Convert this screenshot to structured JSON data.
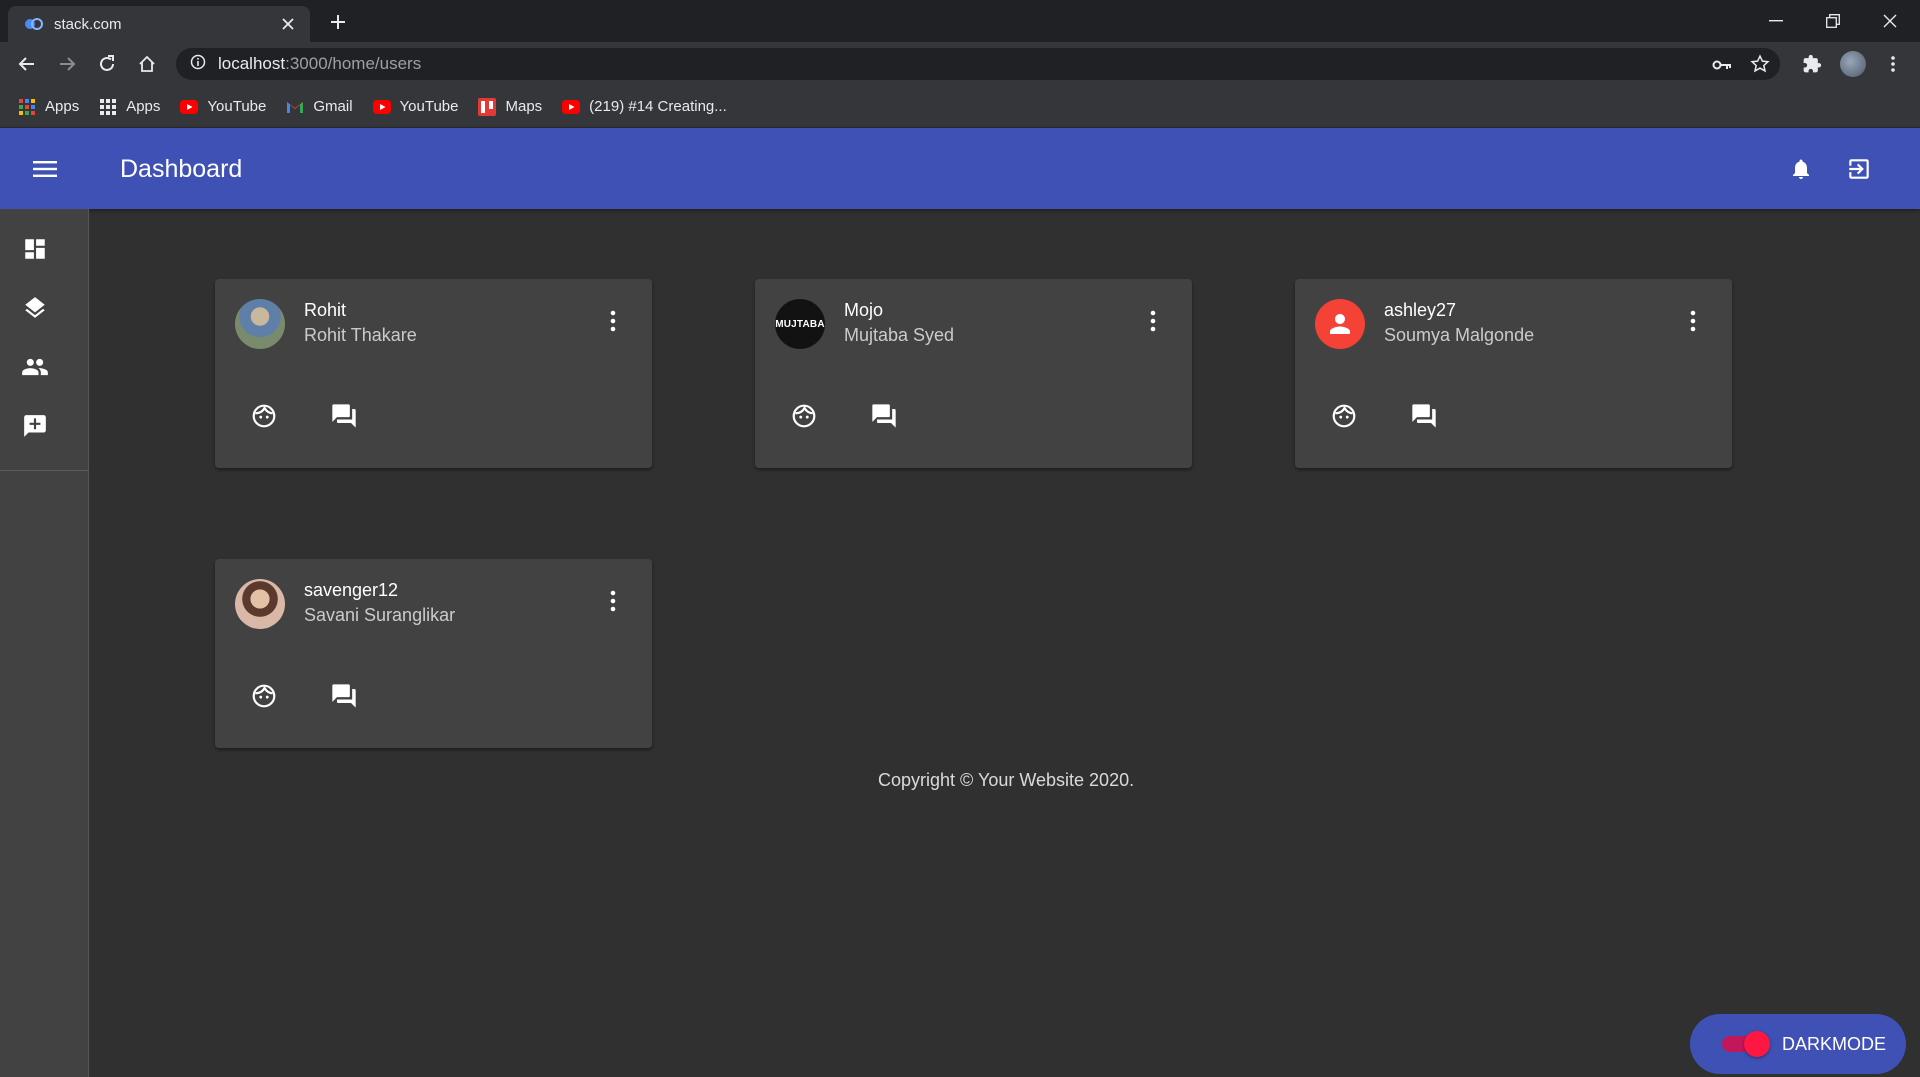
{
  "browser": {
    "tab_title": "stack.com",
    "url_host": "localhost",
    "url_path": ":3000/home/users",
    "bookmarks": [
      {
        "label": "Apps",
        "icon": "apps-grid-colored-icon"
      },
      {
        "label": "Apps",
        "icon": "apps-grid-icon"
      },
      {
        "label": "YouTube",
        "icon": "youtube-icon"
      },
      {
        "label": "Gmail",
        "icon": "gmail-icon"
      },
      {
        "label": "YouTube",
        "icon": "youtube-icon"
      },
      {
        "label": "Maps",
        "icon": "maps-icon"
      },
      {
        "label": "(219) #14 Creating...",
        "icon": "youtube-icon"
      }
    ]
  },
  "appbar": {
    "title": "Dashboard"
  },
  "users": [
    {
      "username": "Rohit",
      "name": "Rohit Thakare",
      "avatar": "photo"
    },
    {
      "username": "Mojo",
      "name": "Mujtaba Syed",
      "avatar": "MUJTABA"
    },
    {
      "username": "ashley27",
      "name": "Soumya Malgonde",
      "avatar": "default-person"
    },
    {
      "username": "savenger12",
      "name": "Savani Suranglikar",
      "avatar": "photo"
    }
  ],
  "footer": {
    "copyright": "Copyright © Your Website 2020."
  },
  "darkmode": {
    "label": "DARKMODE",
    "on": true
  },
  "colors": {
    "primary": "#3f51b5",
    "background": "#303030",
    "card": "#424242",
    "accent": "#ff1744"
  }
}
